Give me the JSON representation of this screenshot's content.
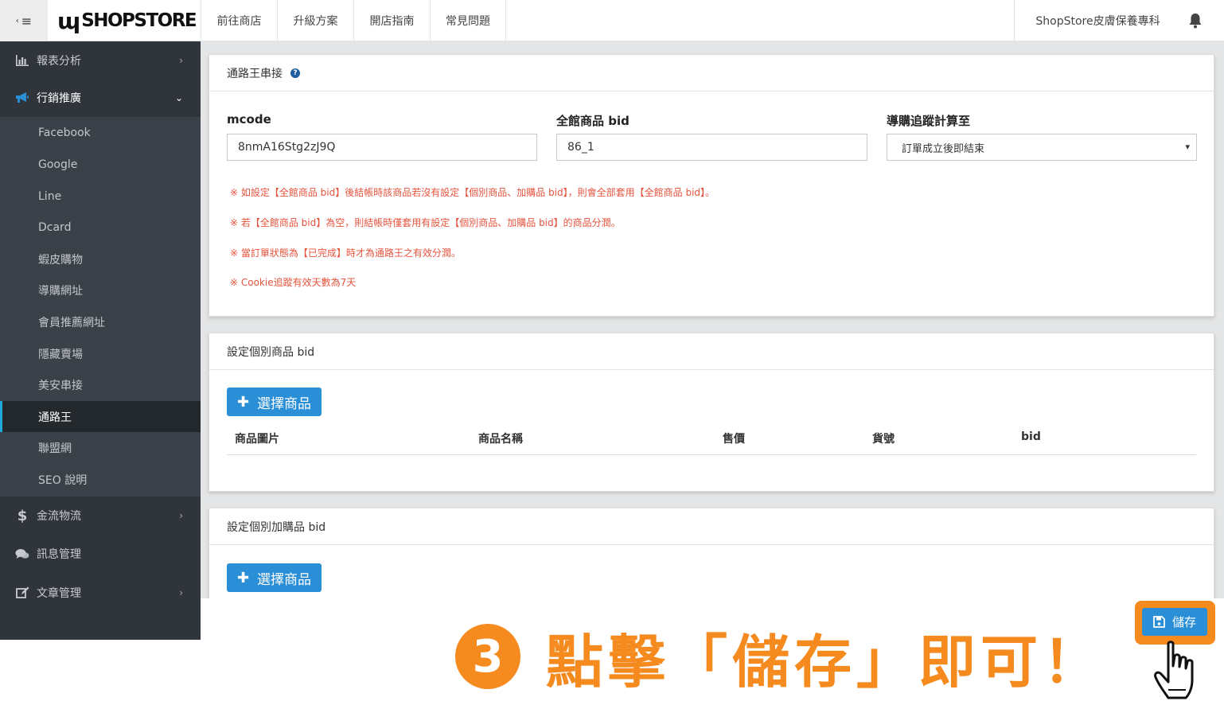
{
  "topbar": {
    "menu_toggle_glyph": "≡",
    "logo_mark": "ɰ",
    "logo_text": "SHOPSTORE",
    "nav": [
      "前往商店",
      "升級方案",
      "開店指南",
      "常見問題"
    ],
    "store_name": "ShopStore皮膚保養專科"
  },
  "sidebar": {
    "items": [
      {
        "label": "報表分析",
        "icon": "bar-chart-icon"
      },
      {
        "label": "行銷推廣",
        "icon": "megaphone-icon"
      },
      {
        "label": "金流物流",
        "icon": "dollar-icon"
      },
      {
        "label": "訊息管理",
        "icon": "comments-icon"
      },
      {
        "label": "文章管理",
        "icon": "edit-icon"
      }
    ],
    "submenu": [
      "Facebook",
      "Google",
      "Line",
      "Dcard",
      "蝦皮購物",
      "導購網址",
      "會員推薦網址",
      "隱藏賣場",
      "美安串接",
      "通路王",
      "聯盟網",
      "SEO 說明"
    ],
    "active_sub": "通路王"
  },
  "card1": {
    "title": "通路王串接",
    "mcode_label": "mcode",
    "mcode_value": "8nmA16Stg2zJ9Q",
    "bid_label": "全館商品 bid",
    "bid_value": "86_1",
    "track_label": "導購追蹤計算至",
    "track_value": "訂單成立後即結束",
    "notes": [
      "※ 如設定【全館商品 bid】後結帳時該商品若沒有設定【個別商品、加購品 bid】，則會全部套用【全館商品 bid】。",
      "※ 若【全館商品 bid】為空，則結帳時僅套用有設定【個別商品、加購品 bid】的商品分潤。",
      "※ 當訂單狀態為【已完成】時才為通路王之有效分潤。",
      "※ Cookie追蹤有效天數為7天"
    ]
  },
  "card2": {
    "title": "設定個別商品 bid",
    "button": "選擇商品",
    "columns": [
      "商品圖片",
      "商品名稱",
      "售價",
      "貨號",
      "bid"
    ]
  },
  "card3": {
    "title": "設定個別加購品 bid",
    "button": "選擇商品"
  },
  "save_button": "儲存",
  "callout": {
    "number": "3",
    "text": "點擊「儲存」即可！"
  },
  "colors": {
    "sidebar_bg": "#2f353b",
    "primary": "#2a8fd6",
    "accent": "#f58a1f",
    "note_red": "#e5533d"
  }
}
